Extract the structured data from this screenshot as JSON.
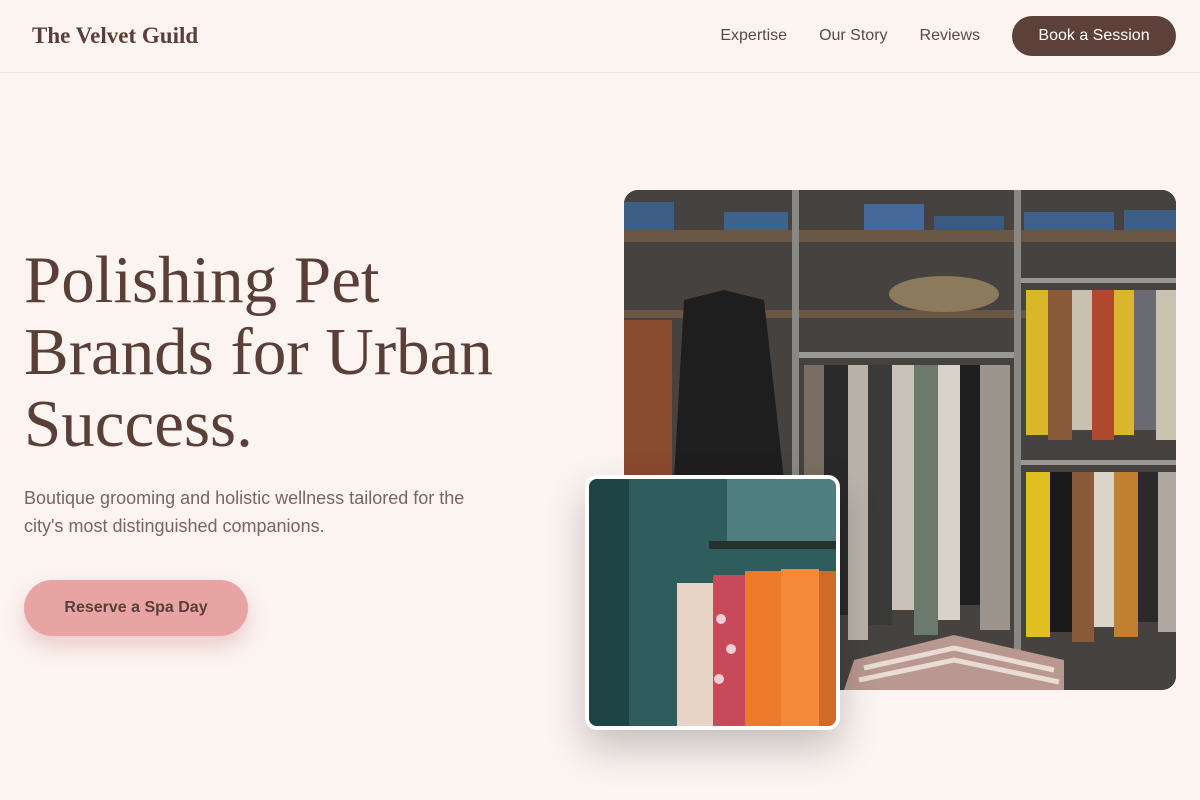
{
  "header": {
    "brand": "The Velvet Guild",
    "nav": [
      "Expertise",
      "Our Story",
      "Reviews"
    ],
    "book_label": "Book a Session"
  },
  "hero": {
    "title": "Polishing Pet Brands for Urban Success.",
    "subtitle": "Boutique grooming and holistic wellness tailored for the city's most distinguished companions.",
    "cta_label": "Reserve a Spa Day"
  },
  "colors": {
    "background": "#fcf4f1",
    "brand_text": "#5a3f38",
    "book_button": "#5c4039",
    "cta_button": "#e8a3a3"
  },
  "images": {
    "main": "clothing-store-racks-photo",
    "secondary": "orange-clothing-rack-photo"
  }
}
